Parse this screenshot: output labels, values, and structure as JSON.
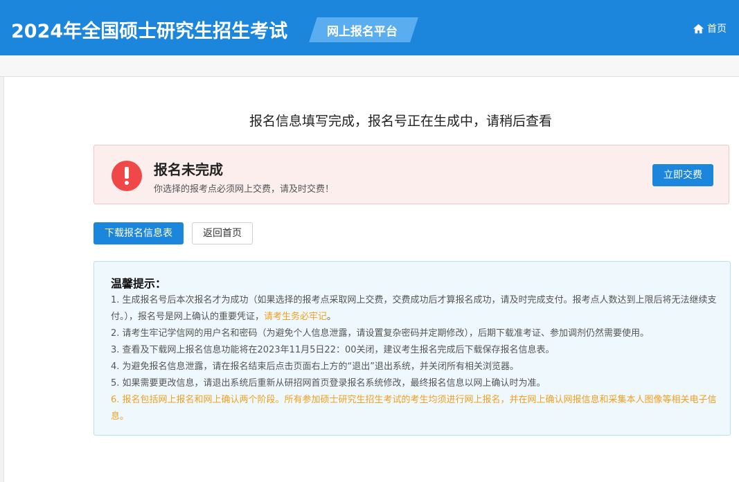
{
  "header": {
    "title": "2024年全国硕士研究生招生考试",
    "platform": "网上报名平台",
    "home_label": "首页"
  },
  "main": {
    "headline": "报名信息填写完成，报名号正在生成中，请稍后查看",
    "alert": {
      "title": "报名未完成",
      "description": "你选择的报考点必须网上交费，请及时交费！",
      "pay_button": "立即交费"
    },
    "buttons": {
      "download": "下载报名信息表",
      "back_home": "返回首页"
    },
    "tips": {
      "title": "温馨提示：",
      "item1_a": "1. 生成报名号后本次报名才为成功（如果选择的报考点采取网上交费，交费成功后才算报名成功，请及时完成支付。报考点人数达到上限后将无法继续支付。），报名号是网上确认的重要凭证，",
      "item1_highlight": "请考生务必牢记",
      "item1_end": "。",
      "item2": "2. 请考生牢记学信网的用户名和密码（为避免个人信息泄露，请设置复杂密码并定期修改），后期下载准考证、参加调剂仍然需要使用。",
      "item3": "3. 查看及下载网上报名信息功能将在2023年11月5日22：00关闭，建议考生报名完成后下载保存报名信息表。",
      "item4": "4. 为避免报名信息泄露，请在报名结束后点击页面右上方的“退出”退出系统，并关闭所有相关浏览器。",
      "item5": "5. 如果需要更改信息，请退出系统后重新从研招网首页登录报名系统修改，最终报名信息以网上确认时为准。",
      "item6": "6. 报名包括网上报名和网上确认两个阶段。所有参加硕士研究生招生考试的考生均须进行网上报名，并在网上确认网报信息和采集本人图像等相关电子信息。"
    }
  },
  "colors": {
    "header_bg": "#1b86dc",
    "primary": "#1b86dc",
    "alert_bg": "#fdeeee",
    "alert_icon": "#f04848",
    "tips_bg": "#eff8fd",
    "highlight": "#f0a020"
  },
  "icons": {
    "home": "home-icon",
    "alert": "exclamation-circle-icon"
  }
}
